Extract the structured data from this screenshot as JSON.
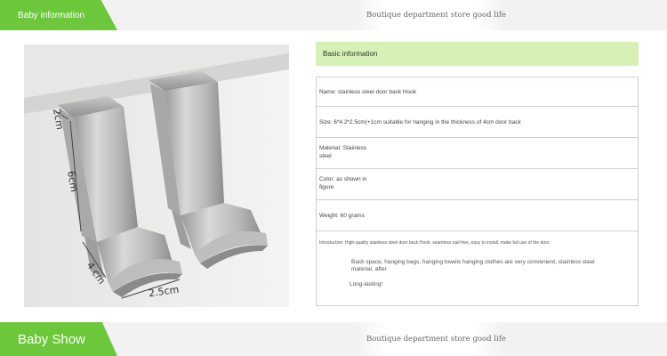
{
  "top_bar": {
    "tab_label": "Baby information",
    "slogan": "Boutique department store good life"
  },
  "photo": {
    "dim_depth": "2cm",
    "dim_height": "6cm",
    "dim_width": "4 cm",
    "dim_hook": "2.5cm"
  },
  "info": {
    "header": "Basic information",
    "rows": [
      "Name: stainless steel door back Hook",
      "Size: 6*4.2*2.5cm(+1cm suitable for hanging in the thickness of 4cm door back",
      "Material: Stainless steel",
      "Color: as shown in figure",
      "Weight: 60 grams"
    ],
    "intro": {
      "line1": "Introduction: High-quality stainless steel door back Hook, seamless nail-free, easy to install, make full use of the door.",
      "line2": "Back space, hanging bags, hanging towels hanging clothes are very convenient, stainless steel material, after",
      "line3": "Long-lasting!"
    }
  },
  "bottom_bar": {
    "tab_label": "Baby Show",
    "slogan": "Boutique department store good life"
  }
}
